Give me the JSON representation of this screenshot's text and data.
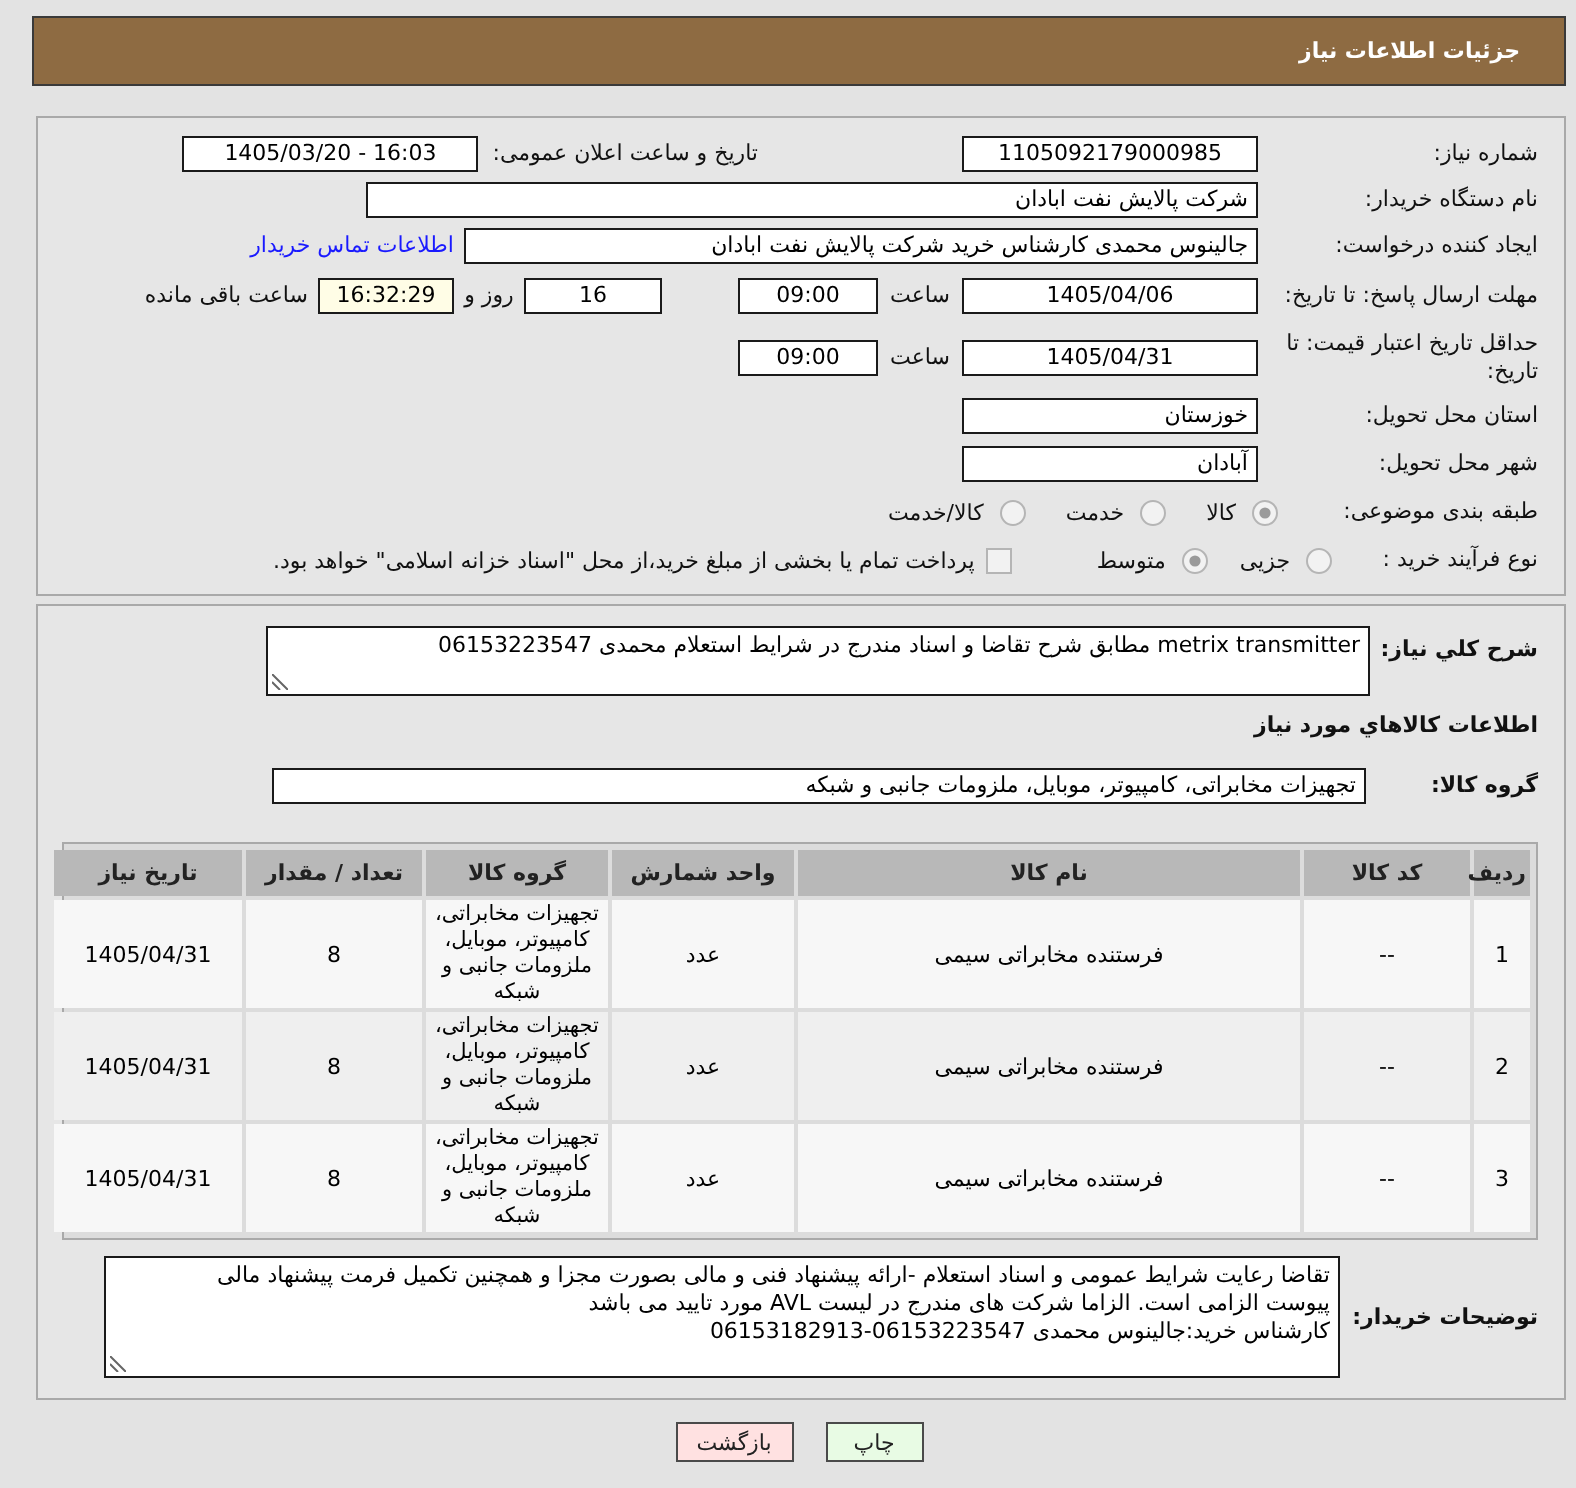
{
  "header": {
    "title": "جزئیات اطلاعات نیاز"
  },
  "need_number": {
    "label": "شماره نیاز:",
    "value": "1105092179000985"
  },
  "announce_datetime": {
    "label": "تاریخ و ساعت اعلان عمومی:",
    "value": "1405/03/20 - 16:03"
  },
  "buyer_org": {
    "label": "نام دستگاه خریدار:",
    "value": "شرکت پالایش نفت ابادان"
  },
  "requester": {
    "label": "ایجاد کننده درخواست:",
    "value": "جالینوس محمدی کارشناس خرید  شرکت پالایش نفت ابادان",
    "link": "اطلاعات تماس خریدار"
  },
  "response_deadline": {
    "label": "مهلت ارسال پاسخ: تا تاریخ:",
    "date": "1405/04/06",
    "time_label": "ساعت",
    "time": "09:00",
    "days": "16",
    "days_label": "روز و",
    "remaining": "16:32:29",
    "remaining_label": "ساعت باقی مانده"
  },
  "price_validity": {
    "label": "حداقل تاریخ اعتبار قیمت: تا تاریخ:",
    "date": "1405/04/31",
    "time_label": "ساعت",
    "time": "09:00"
  },
  "province": {
    "label": "استان محل تحویل:",
    "value": "خوزستان"
  },
  "city": {
    "label": "شهر محل تحویل:",
    "value": "آبادان"
  },
  "category": {
    "label": "طبقه بندی موضوعی:",
    "options": [
      {
        "label": "کالا",
        "selected": true
      },
      {
        "label": "خدمت",
        "selected": false
      },
      {
        "label": "کالا/خدمت",
        "selected": false
      }
    ]
  },
  "purchase_type": {
    "label": "نوع فرآیند خرید :",
    "options": [
      {
        "label": "جزیی",
        "selected": false
      },
      {
        "label": "متوسط",
        "selected": true
      }
    ],
    "treasury": {
      "label": "پرداخت تمام یا بخشی از مبلغ خرید،از محل \"اسناد خزانه اسلامی\" خواهد بود.",
      "checked": false
    }
  },
  "description": {
    "label": "شرح کلي نياز:",
    "value": "metrix transmitter مطابق شرح تقاضا و اسناد مندرج در شرایط استعلام محمدی 06153223547"
  },
  "goods_section": {
    "title": "اطلاعات كالاهاي مورد نياز"
  },
  "goods_group": {
    "label": "گروه کالا:",
    "value": "تجهیزات مخابراتی، کامپیوتر، موبایل، ملزومات جانبی و شبکه"
  },
  "table": {
    "columns": [
      "ردیف",
      "کد کالا",
      "نام کالا",
      "واحد شمارش",
      "گروه کالا",
      "تعداد / مقدار",
      "تاریخ نیاز"
    ],
    "rows": [
      [
        "1",
        "--",
        "فرستنده مخابراتی سیمی",
        "عدد",
        "تجهیزات مخابراتی، کامپیوتر، موبایل، ملزومات جانبی و شبکه",
        "8",
        "1405/04/31"
      ],
      [
        "2",
        "--",
        "فرستنده مخابراتی سیمی",
        "عدد",
        "تجهیزات مخابراتی، کامپیوتر، موبایل، ملزومات جانبی و شبکه",
        "8",
        "1405/04/31"
      ],
      [
        "3",
        "--",
        "فرستنده مخابراتی سیمی",
        "عدد",
        "تجهیزات مخابراتی، کامپیوتر، موبایل، ملزومات جانبی و شبکه",
        "8",
        "1405/04/31"
      ]
    ]
  },
  "buyer_notes": {
    "label": "توضیحات خریدار:",
    "lines": [
      "تقاضا رعایت شرایط عمومی و اسناد استعلام -ارائه پیشنهاد فنی و مالی بصورت مجزا و همچنین تکمیل فرمت پیشنهاد مالی",
      "پیوست الزامی است. الزاما شرکت های مندرج  در لیست AVL مورد تایید می باشد",
      "کارشناس خرید:جالینوس محمدی 06153223547-06153182913"
    ]
  },
  "buttons": [
    {
      "label": "چاپ",
      "kind": "print"
    },
    {
      "label": "بازگشت",
      "kind": "back"
    }
  ]
}
